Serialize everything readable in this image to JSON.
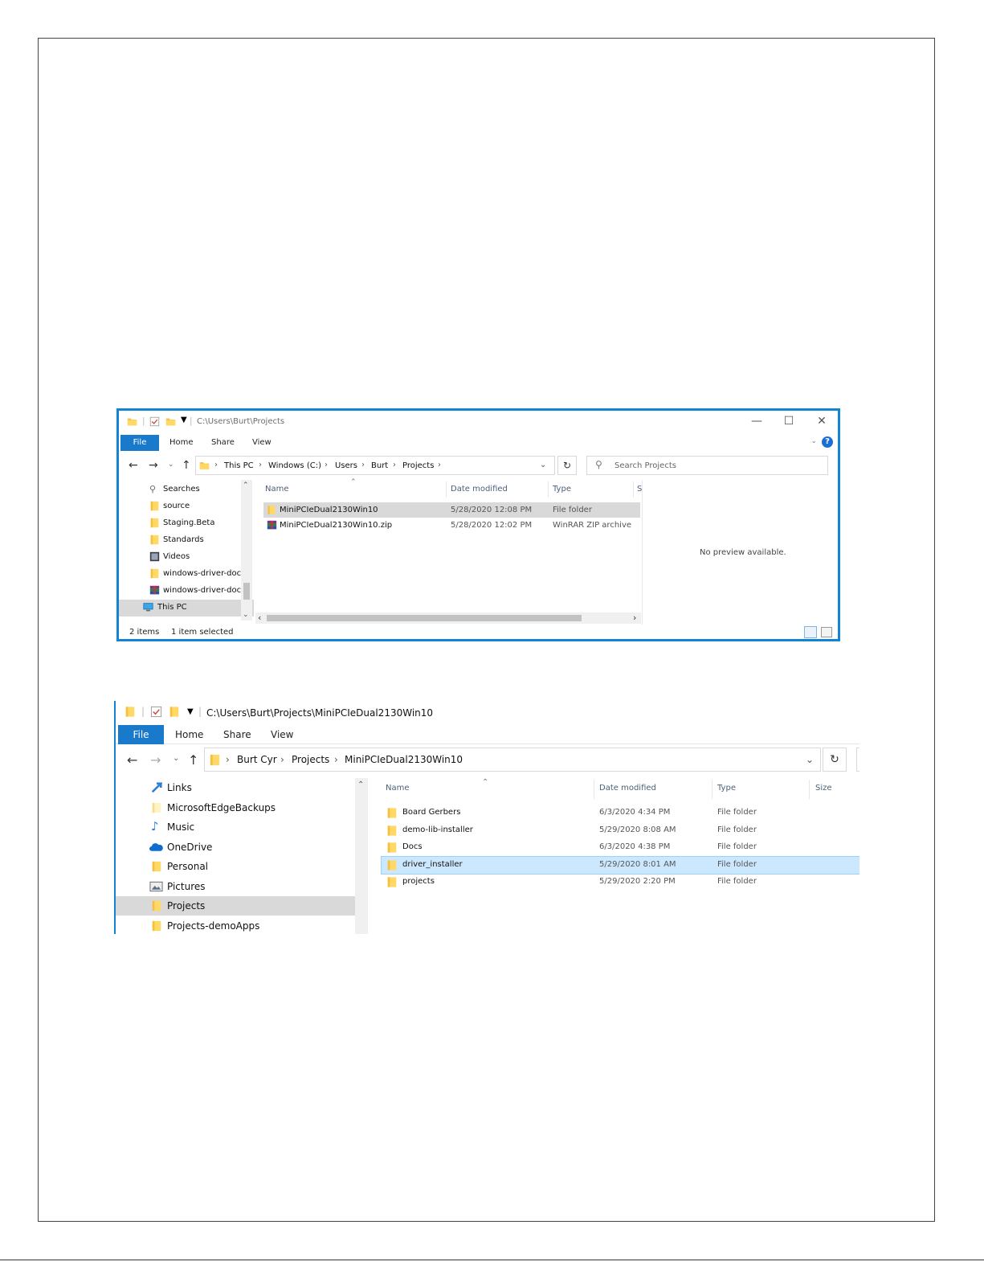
{
  "window1": {
    "title_path": "C:\\Users\\Burt\\Projects",
    "ribbon": {
      "file": "File",
      "tabs": [
        "Home",
        "Share",
        "View"
      ]
    },
    "breadcrumb": [
      "This PC",
      "Windows (C:)",
      "Users",
      "Burt",
      "Projects"
    ],
    "search_placeholder": "Search Projects",
    "nav_items": [
      {
        "label": "Searches",
        "icon": "search-icon"
      },
      {
        "label": "source",
        "icon": "folder-icon"
      },
      {
        "label": "Staging.Beta",
        "icon": "folder-icon"
      },
      {
        "label": "Standards",
        "icon": "folder-icon"
      },
      {
        "label": "Videos",
        "icon": "videos-icon"
      },
      {
        "label": "windows-driver-doc",
        "icon": "folder-icon"
      },
      {
        "label": "windows-driver-doc",
        "icon": "winrar-icon"
      },
      {
        "label": "This PC",
        "icon": "computer-icon"
      }
    ],
    "columns": [
      "Name",
      "Date modified",
      "Type",
      "S"
    ],
    "files": [
      {
        "name": "MiniPCIeDual2130Win10",
        "date": "5/28/2020 12:08 PM",
        "type": "File folder",
        "icon": "folder-icon"
      },
      {
        "name": "MiniPCIeDual2130Win10.zip",
        "date": "5/28/2020 12:02 PM",
        "type": "WinRAR ZIP archive",
        "icon": "winrar-icon"
      }
    ],
    "preview_text": "No preview available.",
    "status": {
      "count": "2 items",
      "selection": "1 item selected"
    }
  },
  "window2": {
    "title_path": "C:\\Users\\Burt\\Projects\\MiniPCIeDual2130Win10",
    "ribbon": {
      "file": "File",
      "tabs": [
        "Home",
        "Share",
        "View"
      ]
    },
    "breadcrumb": [
      "Burt Cyr",
      "Projects",
      "MiniPCIeDual2130Win10"
    ],
    "nav_items": [
      {
        "label": "Links",
        "icon": "links-icon"
      },
      {
        "label": "MicrosoftEdgeBackups",
        "icon": "folder-icon"
      },
      {
        "label": "Music",
        "icon": "music-icon"
      },
      {
        "label": "OneDrive",
        "icon": "onedrive-icon"
      },
      {
        "label": "Personal",
        "icon": "folder-icon"
      },
      {
        "label": "Pictures",
        "icon": "pictures-icon"
      },
      {
        "label": "Projects",
        "icon": "folder-icon"
      },
      {
        "label": "Projects-demoApps",
        "icon": "folder-icon"
      }
    ],
    "columns": [
      "Name",
      "Date modified",
      "Type",
      "Size"
    ],
    "files": [
      {
        "name": "Board Gerbers",
        "date": "6/3/2020 4:34 PM",
        "type": "File folder"
      },
      {
        "name": "demo-lib-installer",
        "date": "5/29/2020 8:08 AM",
        "type": "File folder"
      },
      {
        "name": "Docs",
        "date": "6/3/2020 4:38 PM",
        "type": "File folder"
      },
      {
        "name": "driver_installer",
        "date": "5/29/2020 8:01 AM",
        "type": "File folder"
      },
      {
        "name": "projects",
        "date": "5/29/2020 2:20 PM",
        "type": "File folder"
      }
    ]
  },
  "colors": {
    "accent": "#1383d4",
    "file_tab": "#1979ca",
    "selection": "#cce8ff",
    "folder": "#ffd866"
  }
}
